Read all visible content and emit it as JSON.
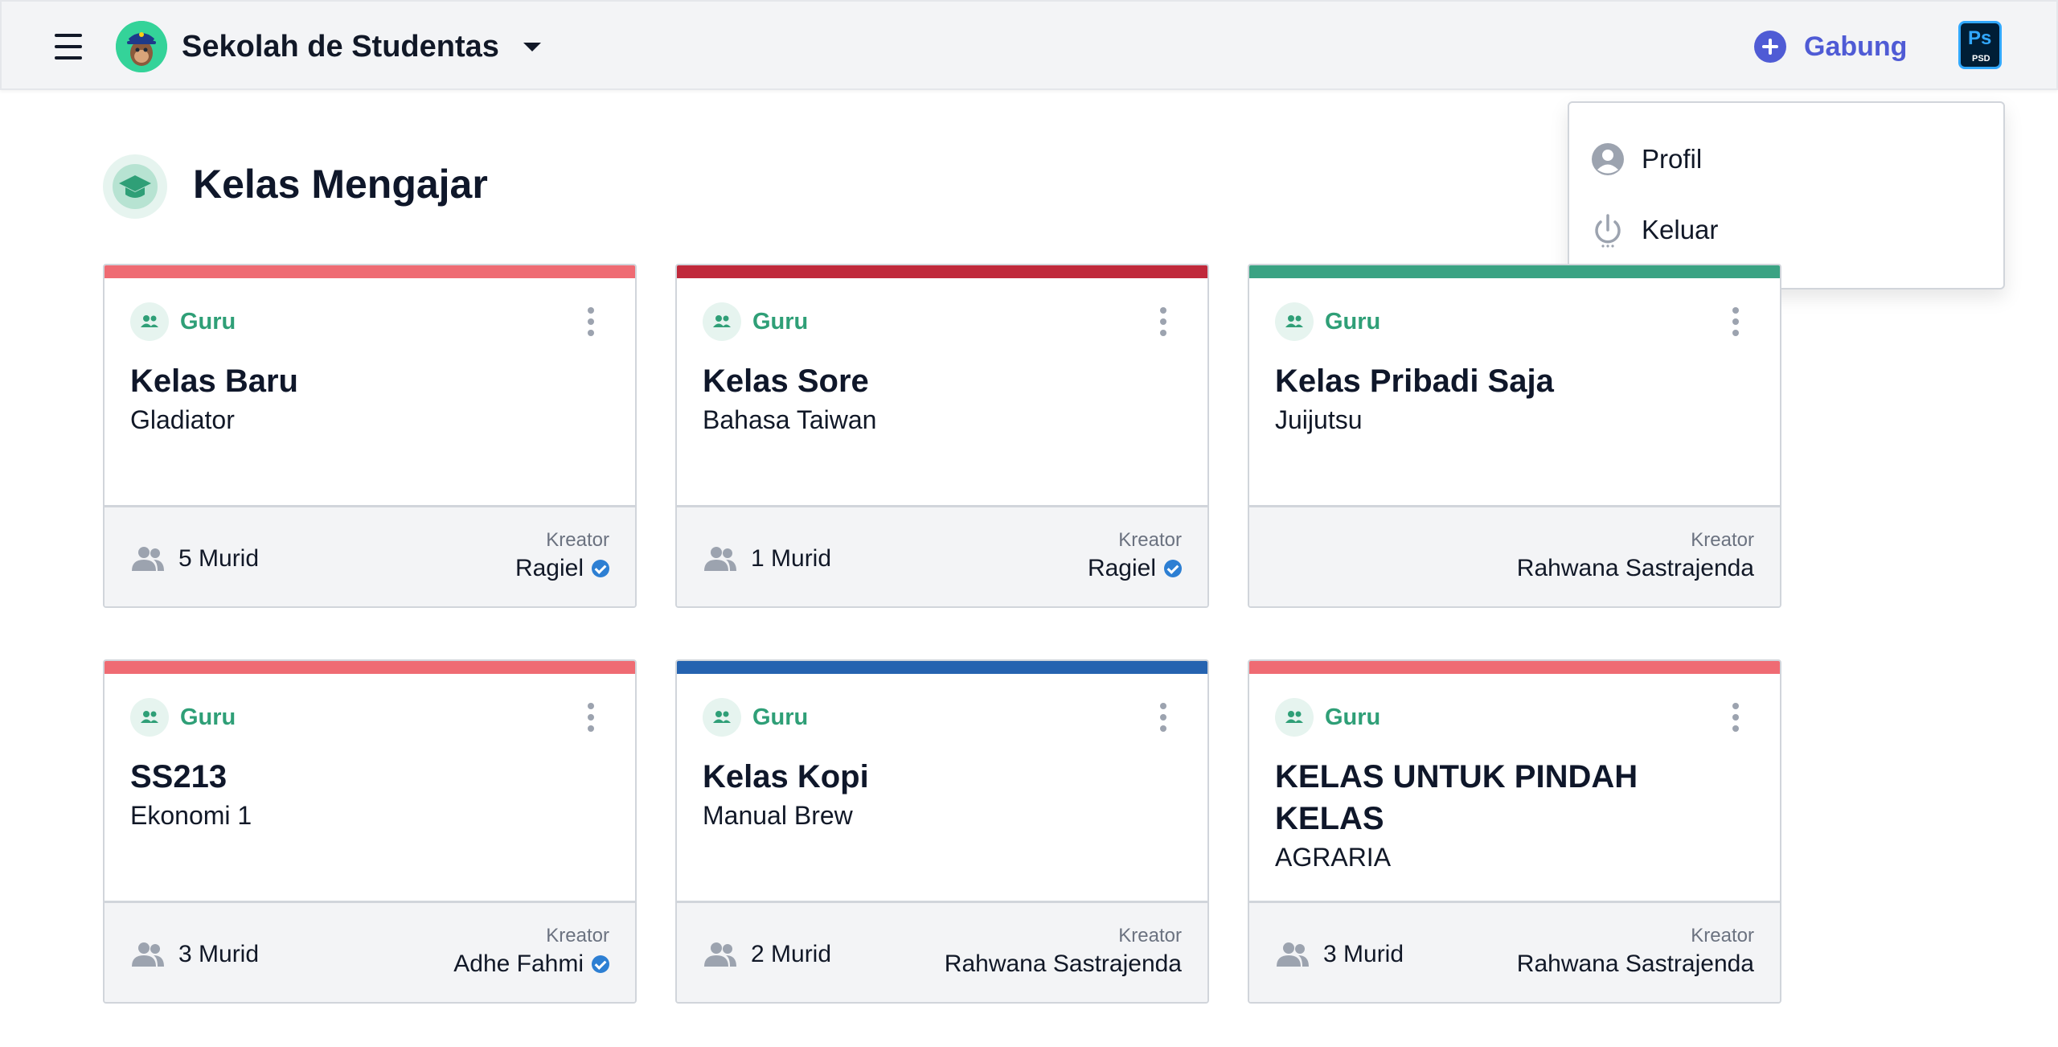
{
  "header": {
    "school_name": "Sekolah de Studentas",
    "join_label": "Gabung",
    "avatar_badge": "Ps",
    "avatar_badge_sub": "PSD"
  },
  "user_menu": {
    "items": [
      {
        "label": "Profil",
        "icon": "user-circle-icon"
      },
      {
        "label": "Keluar",
        "icon": "power-icon"
      }
    ]
  },
  "section": {
    "title": "Kelas Mengajar",
    "icon": "graduation-cap-icon"
  },
  "colors": {
    "accent_green": "#2f9f77",
    "join_blue": "#4f5bd5",
    "stripe_coral": "#ef6b73",
    "stripe_crimson": "#c0293b",
    "stripe_teal": "#3aa383",
    "stripe_blue": "#2563b0"
  },
  "cards": [
    {
      "stripe_color": "#ef6b73",
      "role": "Guru",
      "title": "Kelas Baru",
      "subtitle": "Gladiator",
      "students": "5 Murid",
      "creator_caption": "Kreator",
      "creator": "Ragiel",
      "verified": true
    },
    {
      "stripe_color": "#c0293b",
      "role": "Guru",
      "title": "Kelas Sore",
      "subtitle": "Bahasa Taiwan",
      "students": "1 Murid",
      "creator_caption": "Kreator",
      "creator": "Ragiel",
      "verified": true
    },
    {
      "stripe_color": "#3aa383",
      "role": "Guru",
      "title": "Kelas Pribadi Saja",
      "subtitle": "Juijutsu",
      "students": "",
      "creator_caption": "Kreator",
      "creator": "Rahwana Sastrajenda",
      "verified": false
    },
    {
      "stripe_color": "#ef6b73",
      "role": "Guru",
      "title": "SS213",
      "subtitle": "Ekonomi 1",
      "students": "3 Murid",
      "creator_caption": "Kreator",
      "creator": "Adhe Fahmi",
      "verified": true
    },
    {
      "stripe_color": "#2563b0",
      "role": "Guru",
      "title": "Kelas Kopi",
      "subtitle": "Manual Brew",
      "students": "2 Murid",
      "creator_caption": "Kreator",
      "creator": "Rahwana Sastrajenda",
      "verified": false
    },
    {
      "stripe_color": "#ef6b73",
      "role": "Guru",
      "title": "KELAS UNTUK PINDAH KELAS",
      "subtitle": "AGRARIA",
      "students": "3 Murid",
      "creator_caption": "Kreator",
      "creator": "Rahwana Sastrajenda",
      "verified": false
    }
  ]
}
